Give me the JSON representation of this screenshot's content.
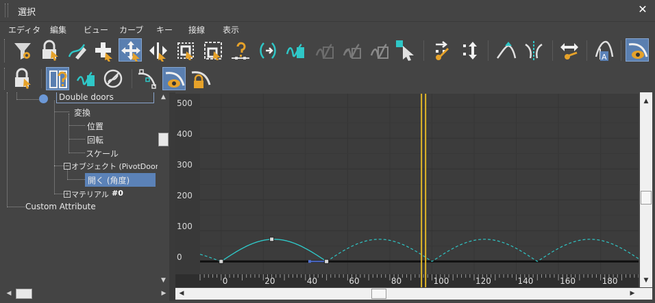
{
  "window": {
    "title": "選択",
    "close_glyph": "✕"
  },
  "menu": [
    "エディタ",
    "編集",
    "ビュー",
    "カーブ",
    "キー",
    "接線",
    "表示"
  ],
  "toolbar1": [
    {
      "name": "filter-icon"
    },
    {
      "name": "lock-selection-icon"
    },
    {
      "name": "draw-curve-icon"
    },
    {
      "name": "add-key-icon"
    },
    {
      "name": "move-key-icon",
      "active": true
    },
    {
      "name": "slide-key-icon"
    },
    {
      "name": "scale-keys-icon"
    },
    {
      "name": "scale-values-icon"
    },
    {
      "name": "region-icon"
    },
    {
      "name": "retime-icon"
    },
    {
      "name": "snap-frames-icon"
    },
    {
      "name": "parameter-out-icon"
    },
    {
      "name": "ease-curve-icon"
    },
    {
      "name": "multiplier-curve-icon"
    },
    {
      "name": "select-key-icon"
    },
    {
      "name": "sync-icon"
    },
    {
      "name": "updown-icon"
    },
    {
      "name": "tangent-fast-icon"
    },
    {
      "name": "tangent-break-icon"
    },
    {
      "name": "range-icon"
    },
    {
      "name": "key-nav-icon"
    },
    {
      "name": "auto-tangent-icon"
    },
    {
      "name": "show-tangents-icon",
      "active": true
    }
  ],
  "toolbar2": [
    {
      "name": "lock-tangent-icon"
    },
    {
      "name": "filter-view-icon",
      "active": true
    },
    {
      "name": "curve-view-icon"
    },
    {
      "name": "no-ease-icon"
    },
    {
      "name": "show-keys-icon"
    },
    {
      "name": "show-tangent-eye-icon",
      "active": true
    },
    {
      "name": "lock-tangent-handle-icon"
    }
  ],
  "tree": {
    "items": [
      {
        "label": "Double doors",
        "level": 0,
        "selected_box": true
      },
      {
        "label": "変換",
        "level": 1
      },
      {
        "label": "位置",
        "level": 2
      },
      {
        "label": "回転",
        "level": 2
      },
      {
        "label": "スケール",
        "level": 2
      },
      {
        "label": "オブジェクト (PivotDoor)",
        "level": 1,
        "expander": "−"
      },
      {
        "label": "開く (角度)",
        "level": 2,
        "highlight": true
      },
      {
        "label": "マテリアル",
        "level": 1,
        "expander": "+",
        "suffix": "#0"
      },
      {
        "label": "Custom Attribute",
        "level": -1
      }
    ]
  },
  "graph": {
    "y_ticks": [
      "500",
      "400",
      "300",
      "200",
      "100",
      "0"
    ],
    "x_ticks": [
      "0",
      "20",
      "40",
      "60",
      "80",
      "100",
      "120",
      "140",
      "160",
      "180"
    ],
    "current_frame": 96,
    "x_range": [
      -10,
      198
    ],
    "y_range": [
      -15,
      540
    ],
    "curve_color": "#2fc7c7",
    "time_slider_color": "#e2b828",
    "key_points": [
      {
        "frame": 0,
        "value": 0
      },
      {
        "frame": 24,
        "value": 72
      },
      {
        "frame": 50,
        "value": 0
      }
    ]
  },
  "colors": {
    "accent": "#5a7fb0",
    "highlight": "#5b82b8",
    "background": "#444444"
  }
}
